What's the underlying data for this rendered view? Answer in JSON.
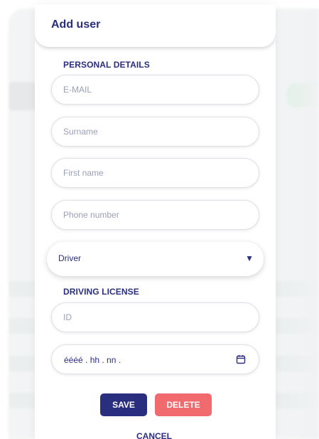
{
  "modal": {
    "title": "Add user",
    "personal_details_label": "PERSONAL DETAILS",
    "fields": {
      "email_placeholder": "E-MAIL",
      "surname_placeholder": "Surname",
      "first_name_placeholder": "First name",
      "phone_placeholder": "Phone number"
    },
    "role_select": {
      "value": "Driver",
      "arrow": "▼"
    },
    "driving_license_label": "DRIVING LICENSE",
    "license_id_placeholder": "ID",
    "date_field": {
      "value": "éééé . hh . nn ."
    },
    "buttons": {
      "save": "SAVE",
      "delete": "DELETE",
      "cancel": "CANCEL"
    },
    "colors": {
      "primary": "#2a2e7f",
      "danger": "#f06a6e"
    }
  }
}
